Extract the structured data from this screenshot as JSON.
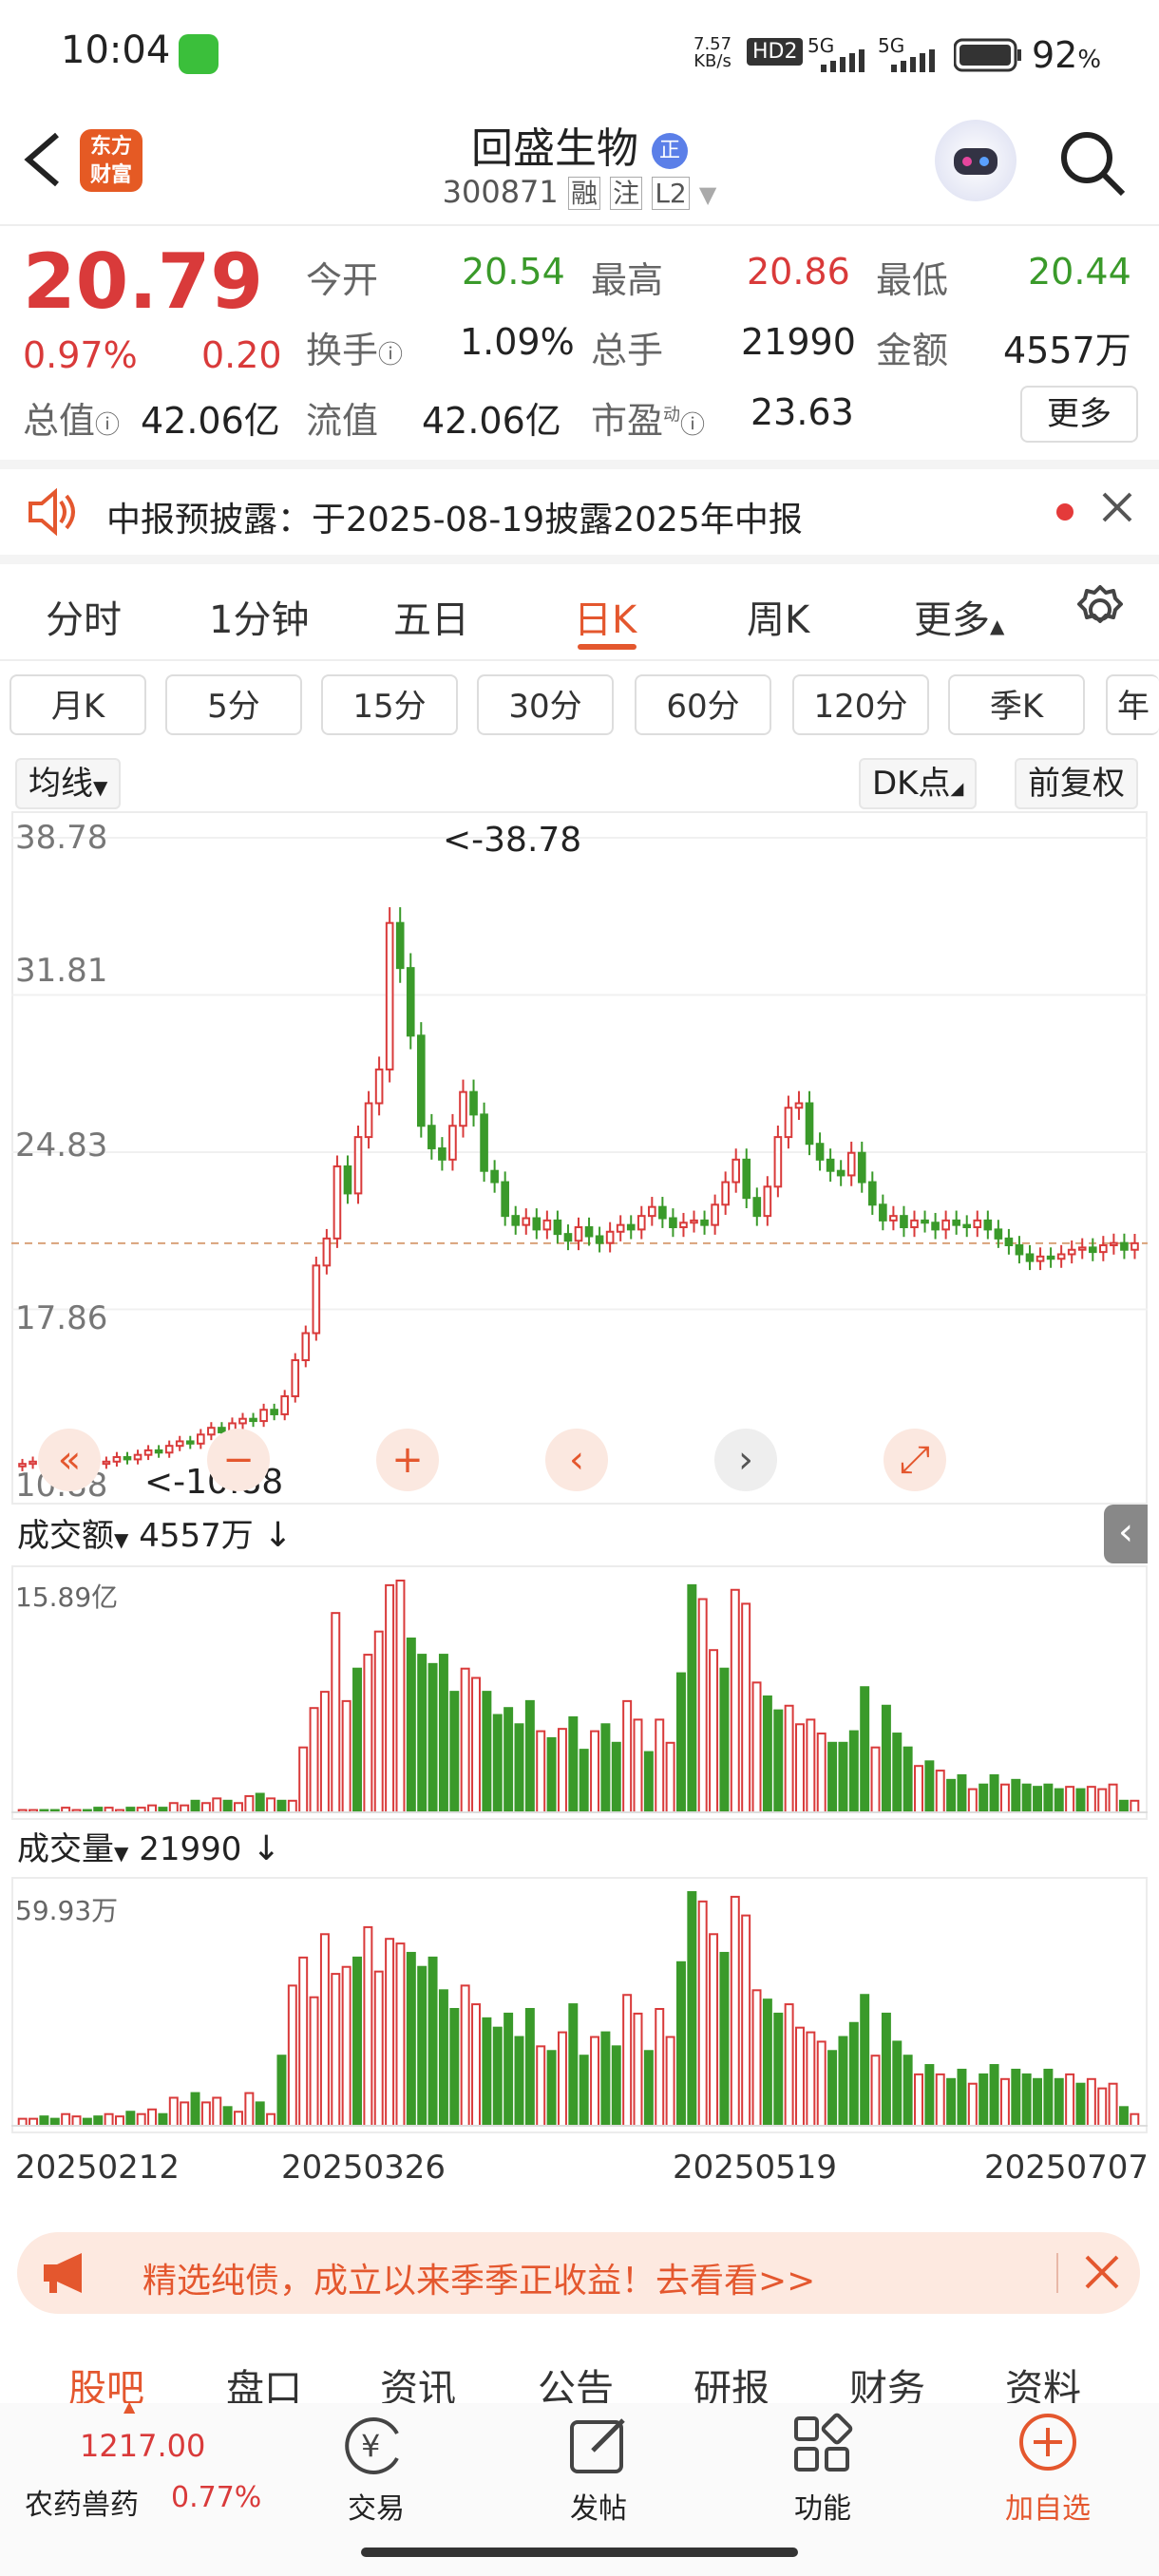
{
  "status_bar": {
    "time": "10:04",
    "net_speed_top": "7.57",
    "net_speed_bottom": "KB/s",
    "hd": "HD2",
    "sig1": "5G",
    "sig2": "5G",
    "battery": "92",
    "battery_unit": "%"
  },
  "nav": {
    "title": "回盛生物",
    "badge": "正",
    "code": "300871",
    "tags": [
      "融",
      "注",
      "L2"
    ],
    "logo_line1": "东方",
    "logo_line2": "财富"
  },
  "quote": {
    "price": "20.79",
    "pct": "0.97%",
    "change": "0.20",
    "open_label": "今开",
    "open": "20.54",
    "high_label": "最高",
    "high": "20.86",
    "low_label": "最低",
    "low": "20.44",
    "turnover_label": "换手",
    "turnover": "1.09%",
    "vol_label": "总手",
    "vol": "21990",
    "amount_label": "金额",
    "amount": "4557万",
    "mcap_label": "总值",
    "mcap": "42.06亿",
    "float_label": "流值",
    "float": "42.06亿",
    "pe_label": "市盈",
    "pe_sup": "动",
    "pe": "23.63",
    "more": "更多"
  },
  "notice": {
    "text": "中报预披露：于2025-08-19披露2025年中报"
  },
  "tabs": [
    "分时",
    "1分钟",
    "五日",
    "日K",
    "周K",
    "更多"
  ],
  "active_tab": "日K",
  "periods": [
    "月K",
    "5分",
    "15分",
    "30分",
    "60分",
    "120分",
    "季K",
    "年"
  ],
  "chart_controls": {
    "ma": "均线",
    "dk": "DK点",
    "adjust": "前复权"
  },
  "chart_data": [
    {
      "type": "candlestick",
      "y_ticks": [
        "38.78",
        "31.81",
        "24.83",
        "17.86",
        "10.88"
      ],
      "ylim": [
        10.88,
        38.78
      ],
      "annotations": [
        {
          "text": "<-38.78"
        },
        {
          "text": "<-10.88"
        }
      ],
      "closes": [
        11.0,
        11.1,
        11.0,
        10.9,
        11.0,
        11.2,
        11.1,
        11.0,
        11.1,
        11.3,
        11.2,
        11.4,
        11.6,
        11.5,
        11.8,
        12.0,
        11.9,
        12.3,
        12.6,
        12.4,
        12.8,
        13.0,
        12.9,
        13.4,
        13.2,
        14.0,
        15.6,
        16.8,
        19.8,
        21.0,
        24.2,
        23.0,
        25.5,
        27.0,
        28.5,
        35.0,
        33.0,
        30.0,
        26.0,
        25.0,
        24.5,
        26.0,
        27.5,
        26.5,
        24.0,
        23.5,
        22.0,
        21.6,
        21.9,
        21.4,
        21.8,
        21.2,
        20.9,
        21.5,
        21.1,
        20.8,
        21.3,
        21.6,
        21.4,
        22.0,
        22.4,
        21.9,
        21.5,
        21.7,
        21.8,
        21.6,
        22.5,
        23.5,
        24.5,
        22.8,
        22.0,
        23.3,
        25.5,
        26.8,
        27.0,
        25.2,
        24.5,
        24.0,
        23.8,
        24.8,
        23.5,
        22.5,
        21.8,
        22.0,
        21.5,
        21.8,
        21.7,
        21.4,
        21.8,
        21.6,
        21.5,
        21.8,
        21.4,
        21.0,
        20.7,
        20.3,
        20.0,
        20.2,
        20.1,
        20.3,
        20.5,
        20.6,
        20.4,
        20.7,
        20.8,
        20.5,
        20.79
      ],
      "last_price_line": 20.79
    },
    {
      "type": "bar",
      "name": "成交额",
      "value_label": "4557万",
      "max_label": "15.89亿",
      "values": [
        0.01,
        0.01,
        0.01,
        0.01,
        0.02,
        0.01,
        0.01,
        0.02,
        0.02,
        0.01,
        0.02,
        0.02,
        0.03,
        0.02,
        0.04,
        0.03,
        0.05,
        0.04,
        0.06,
        0.05,
        0.04,
        0.07,
        0.08,
        0.06,
        0.05,
        0.05,
        0.28,
        0.45,
        0.52,
        0.86,
        0.48,
        0.62,
        0.68,
        0.78,
        0.98,
        1.0,
        0.75,
        0.68,
        0.64,
        0.68,
        0.52,
        0.62,
        0.58,
        0.52,
        0.42,
        0.45,
        0.38,
        0.48,
        0.35,
        0.32,
        0.36,
        0.41,
        0.27,
        0.35,
        0.38,
        0.3,
        0.48,
        0.4,
        0.26,
        0.4,
        0.3,
        0.6,
        0.98,
        0.92,
        0.7,
        0.62,
        0.96,
        0.9,
        0.56,
        0.5,
        0.44,
        0.46,
        0.38,
        0.4,
        0.34,
        0.3,
        0.3,
        0.35,
        0.54,
        0.28,
        0.46,
        0.34,
        0.28,
        0.2,
        0.22,
        0.18,
        0.14,
        0.16,
        0.1,
        0.12,
        0.16,
        0.12,
        0.14,
        0.12,
        0.11,
        0.12,
        0.1,
        0.11,
        0.1,
        0.11,
        0.1,
        0.12,
        0.05,
        0.05
      ]
    },
    {
      "type": "bar",
      "name": "成交量",
      "value_label": "21990",
      "max_label": "59.93万",
      "values": [
        0.03,
        0.03,
        0.04,
        0.03,
        0.05,
        0.04,
        0.03,
        0.04,
        0.05,
        0.04,
        0.06,
        0.05,
        0.07,
        0.05,
        0.12,
        0.1,
        0.14,
        0.1,
        0.12,
        0.08,
        0.06,
        0.14,
        0.1,
        0.05,
        0.3,
        0.6,
        0.72,
        0.55,
        0.82,
        0.65,
        0.68,
        0.72,
        0.85,
        0.66,
        0.8,
        0.78,
        0.74,
        0.68,
        0.72,
        0.58,
        0.5,
        0.6,
        0.52,
        0.46,
        0.42,
        0.48,
        0.38,
        0.5,
        0.34,
        0.32,
        0.4,
        0.52,
        0.3,
        0.38,
        0.4,
        0.34,
        0.56,
        0.48,
        0.32,
        0.5,
        0.38,
        0.7,
        1.0,
        0.96,
        0.82,
        0.74,
        0.98,
        0.9,
        0.58,
        0.54,
        0.48,
        0.52,
        0.42,
        0.4,
        0.36,
        0.32,
        0.38,
        0.44,
        0.56,
        0.3,
        0.48,
        0.36,
        0.3,
        0.22,
        0.26,
        0.22,
        0.2,
        0.24,
        0.18,
        0.22,
        0.26,
        0.2,
        0.24,
        0.22,
        0.2,
        0.24,
        0.2,
        0.22,
        0.18,
        0.2,
        0.16,
        0.18,
        0.08,
        0.05
      ]
    }
  ],
  "amount_label": "成交额",
  "volume_label": "成交量",
  "dates": [
    "20250212",
    "20250326",
    "20250519",
    "20250707"
  ],
  "ad": {
    "text": "精选纯债，成立以来季季正收益！去看看>>"
  },
  "bottom_tabs": [
    "股吧",
    "盘口",
    "资讯",
    "公告",
    "研报",
    "财务",
    "资料"
  ],
  "sector": {
    "value": "1217.00",
    "name": "农药兽药",
    "pct": "0.77%"
  },
  "bottom_nav": [
    "交易",
    "发帖",
    "功能",
    "加自选"
  ]
}
